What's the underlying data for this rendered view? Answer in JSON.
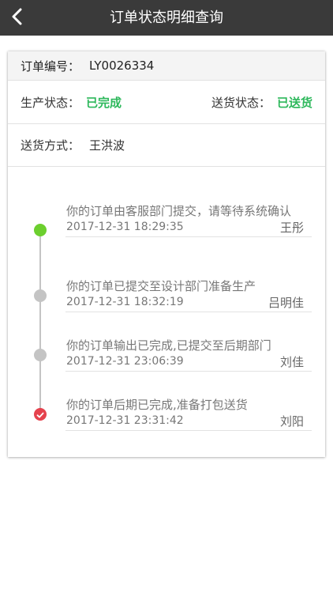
{
  "header": {
    "title": "订单状态明细查询",
    "back_icon": "chevron-left-icon"
  },
  "order": {
    "number_label": "订单编号：",
    "number_value": "LY0026334",
    "production_label": "生产状态：",
    "production_value": "已完成",
    "delivery_status_label": "送货状态：",
    "delivery_status_value": "已送货",
    "delivery_method_label": "送货方式：",
    "delivery_method_value": "王洪波"
  },
  "colors": {
    "header_bg": "#3a3a3a",
    "status_green": "#2eb85c",
    "dot_green": "#6ccf2e",
    "dot_grey": "#c4c4c4",
    "dot_red": "#e5424d"
  },
  "timeline": [
    {
      "text": "你的订单由客服部门提交，请等待系统确认",
      "time": "2017-12-31 18:29:35",
      "person": "王彤",
      "state": "current-green"
    },
    {
      "text": "你的订单已提交至设计部门准备生产",
      "time": "2017-12-31 18:32:19",
      "person": "吕明佳",
      "state": "grey"
    },
    {
      "text": "你的订单输出已完成,已提交至后期部门",
      "time": "2017-12-31 23:06:39",
      "person": "刘佳",
      "state": "grey"
    },
    {
      "text": "你的订单后期已完成,准备打包送货",
      "time": "2017-12-31 23:31:42",
      "person": "刘阳",
      "state": "check-red"
    }
  ]
}
